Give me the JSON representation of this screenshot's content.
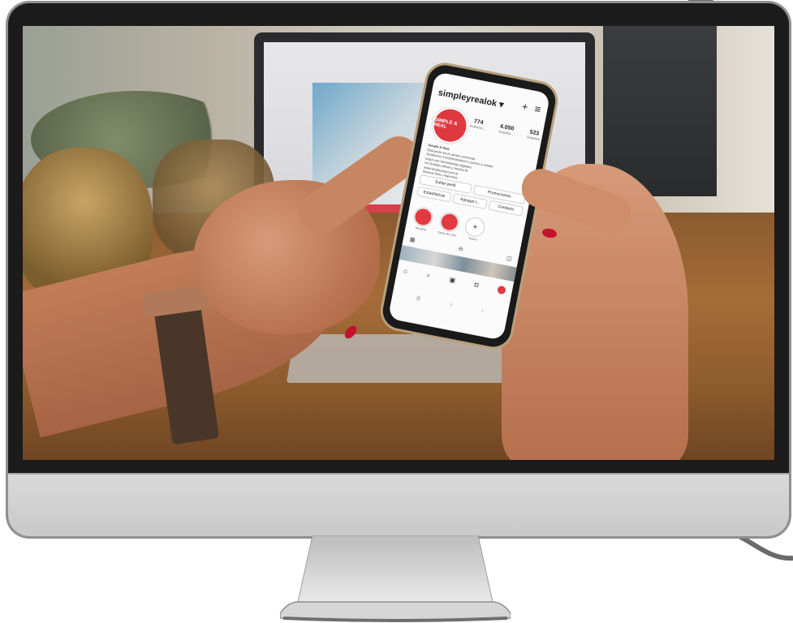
{
  "phone_app": {
    "username": "simpleyrealok ▾",
    "avatar_text": "SIMPLE & REAL",
    "stats": [
      {
        "value": "774",
        "label": "Publicaci..."
      },
      {
        "value": "4.050",
        "label": "Seguidor..."
      },
      {
        "value": "523",
        "label": "Seguidos"
      }
    ],
    "bio_lines": [
      "Simple & Real",
      "Educación en el campo comercial",
      "Ayudamos a emprendedores y pymes a vender",
      "mejor con herramientas digitales.",
      "Un humano detrás y mucha IA",
      "www.simpleyreal.com.ar",
      "Buenos Aires, Argentina"
    ],
    "buttons": [
      "Editar perfil",
      "Promociones",
      "Estadísticas",
      "Agregar t...",
      "Contacto"
    ],
    "highlights": [
      "Nosotros",
      "Casos de éxito",
      "Nuevo"
    ],
    "colors": {
      "brand_red": "#e23a40",
      "nail_red": "#c3122a"
    }
  }
}
